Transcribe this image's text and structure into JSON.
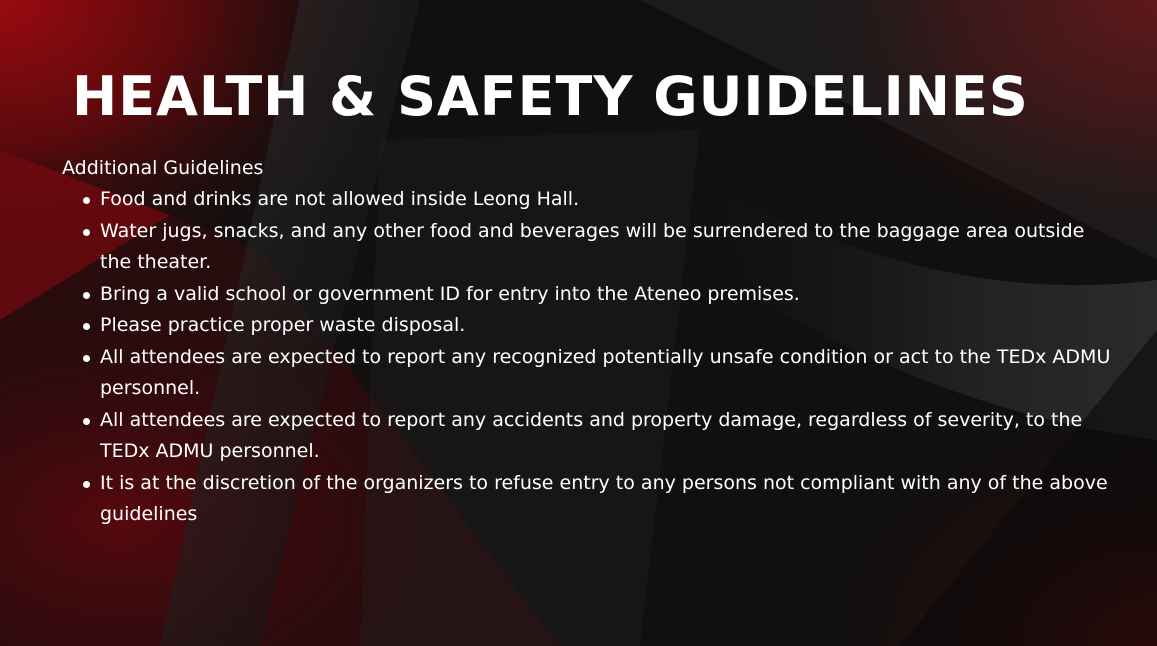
{
  "slide": {
    "title": "HEALTH & SAFETY GUIDELINES",
    "subheading": "Additional Guidelines",
    "items": [
      {
        "text": "Food and drinks are not allowed inside Leong Hall."
      },
      {
        "text": "Water jugs, snacks, and any other food and beverages will be surrendered to the baggage area outside the theater."
      },
      {
        "text": "Bring a valid school or government ID for entry into the Ateneo premises."
      },
      {
        "text": "Please practice proper waste disposal."
      },
      {
        "text": "All attendees are expected to report any recognized potentially unsafe condition or act to the TEDx ADMU personnel."
      },
      {
        "text": "All attendees are expected to report any accidents and property damage, regardless of severity, to the TEDx ADMU personnel."
      },
      {
        "text": "It is at the discretion of the organizers to refuse entry to any persons not compliant with any of the above guidelines"
      }
    ]
  },
  "colors": {
    "background": "#0d0d0d",
    "accent_red": "#8e0b10",
    "text": "#ffffff"
  }
}
